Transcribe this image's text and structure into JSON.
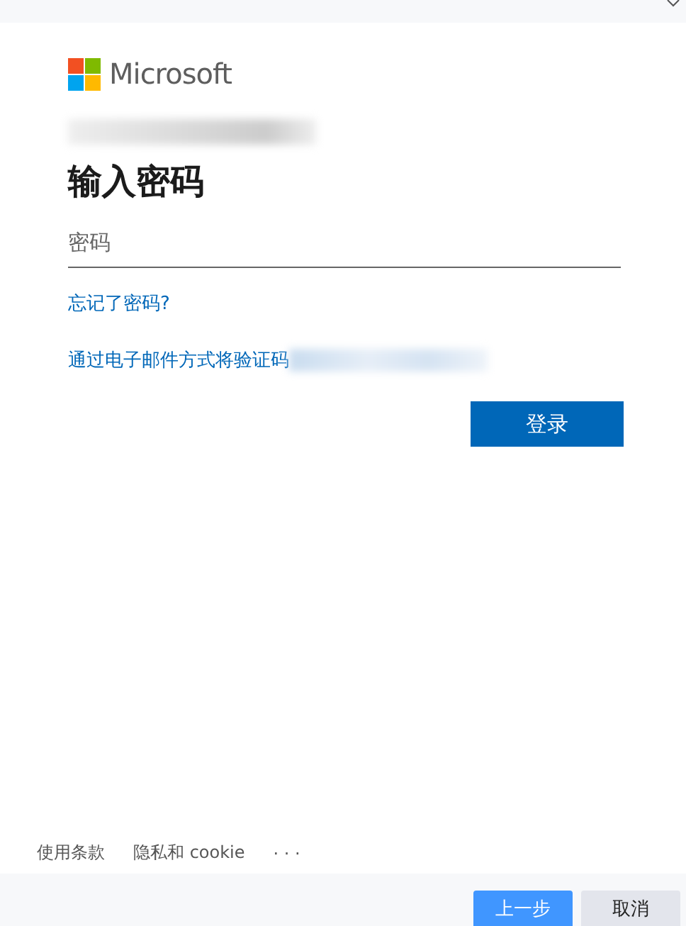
{
  "brand": "Microsoft",
  "heading": "输入密码",
  "password_field": {
    "placeholder": "密码"
  },
  "links": [
    {
      "label": "忘记了密码?",
      "kind": "plain"
    },
    {
      "label": "通过电子邮件方式将验证码",
      "kind": "redacted"
    }
  ],
  "sign_in_button": "登录",
  "footer_links": [
    "使用条款",
    "隐私和 cookie",
    "· · ·"
  ],
  "bottom_buttons": [
    {
      "label": "上一步",
      "kind": "primary"
    },
    {
      "label": "取消",
      "kind": "secondary"
    }
  ]
}
